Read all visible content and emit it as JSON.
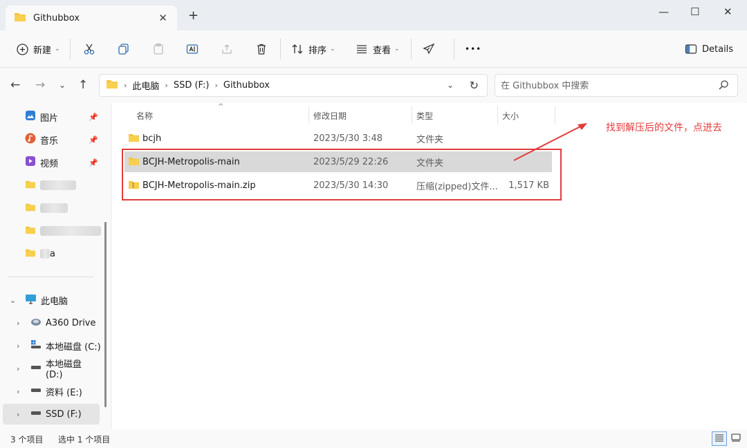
{
  "window": {
    "tab_title": "Githubbox",
    "tab_close": "✕",
    "new_tab": "+",
    "minimize": "—",
    "maximize": "☐",
    "close": "✕"
  },
  "toolbar": {
    "new_label": "新建",
    "sort_label": "排序",
    "view_label": "查看",
    "more_label": "•••",
    "details_label": "Details"
  },
  "address": {
    "crumbs": [
      "此电脑",
      "SSD (F:)",
      "Githubbox"
    ],
    "search_placeholder": "在 Githubbox 中搜索"
  },
  "sidebar": {
    "quick": [
      {
        "label": "图片",
        "icon": "pictures-icon"
      },
      {
        "label": "音乐",
        "icon": "music-icon"
      },
      {
        "label": "视频",
        "icon": "videos-icon"
      }
    ],
    "blurred": [
      "k",
      "a"
    ],
    "this_pc": "此电脑",
    "drives": [
      {
        "label": "A360 Drive"
      },
      {
        "label": "本地磁盘 (C:)"
      },
      {
        "label": "本地磁盘 (D:)"
      },
      {
        "label": "资料 (E:)"
      },
      {
        "label": "SSD (F:)"
      }
    ]
  },
  "columns": {
    "name": "名称",
    "date": "修改日期",
    "type": "类型",
    "size": "大小"
  },
  "files": [
    {
      "name": "bcjh",
      "date": "2023/5/30 3:48",
      "type": "文件夹",
      "size": "",
      "icon": "folder-icon"
    },
    {
      "name": "BCJH-Metropolis-main",
      "date": "2023/5/29 22:26",
      "type": "文件夹",
      "size": "",
      "icon": "folder-icon"
    },
    {
      "name": "BCJH-Metropolis-main.zip",
      "date": "2023/5/30 14:30",
      "type": "压缩(zipped)文件...",
      "size": "1,517 KB",
      "icon": "zip-folder-icon"
    }
  ],
  "annotation": "找到解压后的文件，点进去",
  "status": {
    "count": "3 个项目",
    "selected": "选中 1 个项目"
  },
  "colors": {
    "accent_red": "#e23b3b",
    "folder_yellow": "#f4c542",
    "selected_row": "#d9d9d9"
  }
}
